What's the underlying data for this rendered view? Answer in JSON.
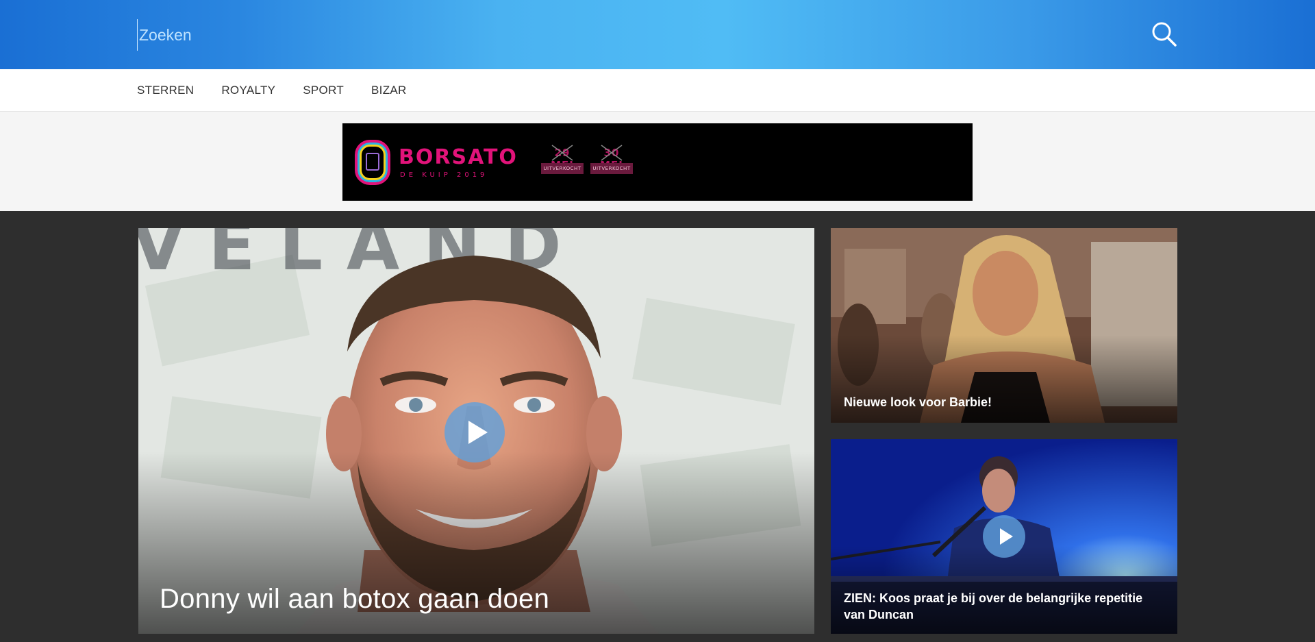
{
  "search": {
    "placeholder": "Zoeken",
    "button_icon": "search-icon"
  },
  "nav": {
    "items": [
      {
        "label": "STERREN"
      },
      {
        "label": "ROYALTY"
      },
      {
        "label": "SPORT"
      },
      {
        "label": "BIZAR"
      }
    ]
  },
  "ad": {
    "title": "BORSATO",
    "subtitle": "DE KUIP 2019",
    "dates": [
      {
        "date": "29 MEI",
        "status": "UITVERKOCHT"
      },
      {
        "date": "30 MEI",
        "status": "UITVERKOCHT"
      }
    ],
    "brand_color": "#e2137a"
  },
  "articles": [
    {
      "headline": "Donny wil aan botox gaan doen",
      "video": true
    },
    {
      "headline": "Nieuwe look voor Barbie!",
      "video": false
    },
    {
      "headline": "ZIEN: Koos praat je bij over de belangrijke repetitie van Duncan",
      "video": true
    }
  ],
  "colors": {
    "header_blue": "#1a6fd4",
    "header_light": "#50bcf5",
    "content_bg": "#2e2e2e",
    "play_button": "#5fa0dc"
  }
}
